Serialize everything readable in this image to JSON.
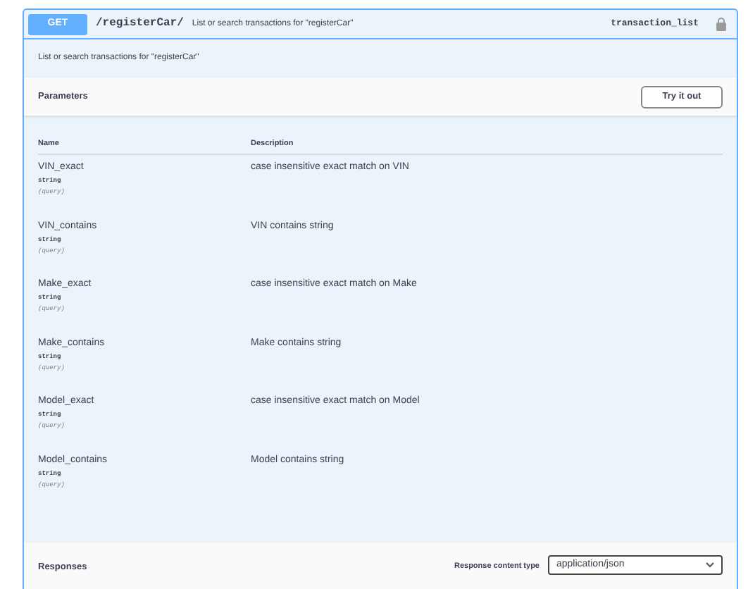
{
  "operation": {
    "method": "GET",
    "path": "/registerCar/",
    "summary": "List or search transactions for \"registerCar\"",
    "operation_id": "transaction_list",
    "locked": true
  },
  "description": "List or search transactions for \"registerCar\"",
  "parameters_section": {
    "title": "Parameters",
    "try_button": "Try it out"
  },
  "table": {
    "columns": [
      "Name",
      "Description"
    ],
    "rows": [
      {
        "name": "VIN_exact",
        "type": "string",
        "location": "(query)",
        "description": "case insensitive exact match on VIN"
      },
      {
        "name": "VIN_contains",
        "type": "string",
        "location": "(query)",
        "description": "VIN contains string"
      },
      {
        "name": "Make_exact",
        "type": "string",
        "location": "(query)",
        "description": "case insensitive exact match on Make"
      },
      {
        "name": "Make_contains",
        "type": "string",
        "location": "(query)",
        "description": "Make contains string"
      },
      {
        "name": "Model_exact",
        "type": "string",
        "location": "(query)",
        "description": "case insensitive exact match on Model"
      },
      {
        "name": "Model_contains",
        "type": "string",
        "location": "(query)",
        "description": "Model contains string"
      }
    ]
  },
  "responses": {
    "title": "Responses",
    "content_type_label": "Response content type",
    "content_type": "application/json"
  }
}
